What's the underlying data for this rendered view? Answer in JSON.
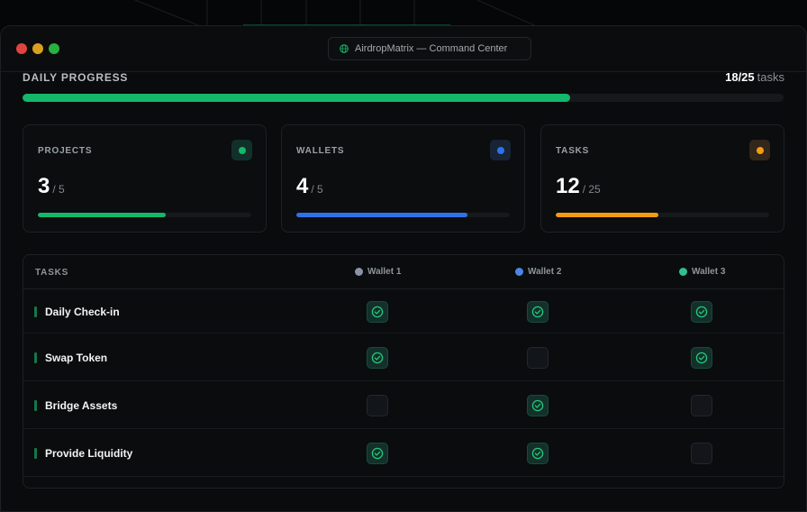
{
  "window": {
    "title": "AirdropMatrix — Command Center",
    "title_icon": "globe-icon"
  },
  "daily_progress": {
    "label": "DAILY PROGRESS",
    "done": "18/25",
    "unit": "tasks",
    "fraction": 0.72,
    "color": "#14b86a"
  },
  "cards": [
    {
      "label": "PROJECTS",
      "value": "3",
      "total": "/ 5",
      "fraction": 0.6,
      "color": "#14b86a",
      "badge_bg": "#12302a"
    },
    {
      "label": "WALLETS",
      "value": "4",
      "total": "/ 5",
      "fraction": 0.8,
      "color": "#2f72e8",
      "badge_bg": "#172436"
    },
    {
      "label": "TASKS",
      "value": "12",
      "total": "/ 25",
      "fraction": 0.48,
      "color": "#f39c12",
      "badge_bg": "#33261a"
    }
  ],
  "table": {
    "header_tasks": "TASKS",
    "wallets": [
      {
        "name": "Wallet 1",
        "color": "#8a93a8"
      },
      {
        "name": "Wallet 2",
        "color": "#4a86e8"
      },
      {
        "name": "Wallet 3",
        "color": "#2fbf8f"
      }
    ],
    "rows": [
      {
        "task": "Daily Check-in",
        "status": [
          true,
          true,
          true
        ]
      },
      {
        "task": "Swap Token",
        "status": [
          true,
          false,
          true
        ]
      },
      {
        "task": "Bridge Assets",
        "status": [
          false,
          true,
          false
        ]
      },
      {
        "task": "Provide Liquidity",
        "status": [
          true,
          true,
          false
        ]
      }
    ]
  }
}
